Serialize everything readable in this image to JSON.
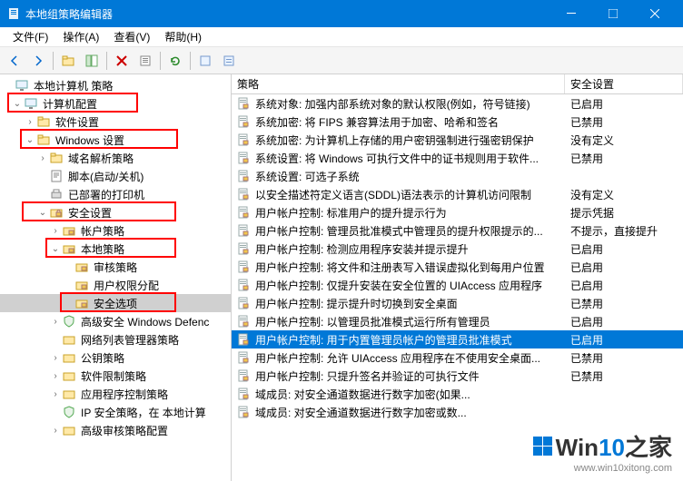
{
  "window": {
    "title": "本地组策略编辑器"
  },
  "menus": {
    "file": "文件(F)",
    "action": "操作(A)",
    "view": "查看(V)",
    "help": "帮助(H)"
  },
  "tree": {
    "root": "本地计算机 策略",
    "computerConfig": "计算机配置",
    "softwareSettings": "软件设置",
    "windowsSettings": "Windows 设置",
    "nameResPolicy": "域名解析策略",
    "scripts": "脚本(启动/关机)",
    "deployedPrinters": "已部署的打印机",
    "securitySettings": "安全设置",
    "accountPolicies": "帐户策略",
    "localPolicies": "本地策略",
    "auditPolicy": "审核策略",
    "userRights": "用户权限分配",
    "securityOptions": "安全选项",
    "windowsDefend": "高级安全 Windows Defenc",
    "netListMgr": "网络列表管理器策略",
    "publicKey": "公钥策略",
    "softwareRestrict": "软件限制策略",
    "appControl": "应用程序控制策略",
    "ipSec": "IP 安全策略，在 本地计算",
    "advAudit": "高级审核策略配置"
  },
  "columns": {
    "policy": "策略",
    "securitySetting": "安全设置"
  },
  "rows": [
    {
      "text": "系统对象: 加强内部系统对象的默认权限(例如，符号链接)",
      "val": "已启用"
    },
    {
      "text": "系统加密: 将 FIPS 兼容算法用于加密、哈希和签名",
      "val": "已禁用"
    },
    {
      "text": "系统加密: 为计算机上存储的用户密钥强制进行强密钥保护",
      "val": "没有定义"
    },
    {
      "text": "系统设置: 将 Windows 可执行文件中的证书规则用于软件...",
      "val": "已禁用"
    },
    {
      "text": "系统设置: 可选子系统",
      "val": ""
    },
    {
      "text": "以安全描述符定义语言(SDDL)语法表示的计算机访问限制",
      "val": "没有定义"
    },
    {
      "text": "用户帐户控制: 标准用户的提升提示行为",
      "val": "提示凭据"
    },
    {
      "text": "用户帐户控制: 管理员批准模式中管理员的提升权限提示的...",
      "val": "不提示，直接提升"
    },
    {
      "text": "用户帐户控制: 检测应用程序安装并提示提升",
      "val": "已启用"
    },
    {
      "text": "用户帐户控制: 将文件和注册表写入错误虚拟化到每用户位置",
      "val": "已启用"
    },
    {
      "text": "用户帐户控制: 仅提升安装在安全位置的 UIAccess 应用程序",
      "val": "已启用"
    },
    {
      "text": "用户帐户控制: 提示提升时切换到安全桌面",
      "val": "已禁用"
    },
    {
      "text": "用户帐户控制: 以管理员批准模式运行所有管理员",
      "val": "已启用"
    },
    {
      "text": "用户帐户控制: 用于内置管理员帐户的管理员批准模式",
      "val": "已启用",
      "selected": true
    },
    {
      "text": "用户帐户控制: 允许 UIAccess 应用程序在不使用安全桌面...",
      "val": "已禁用"
    },
    {
      "text": "用户帐户控制: 只提升签名并验证的可执行文件",
      "val": "已禁用"
    },
    {
      "text": "域成员: 对安全通道数据进行数字加密(如果...",
      "val": ""
    },
    {
      "text": "域成员: 对安全通道数据进行数字加密或数...",
      "val": ""
    }
  ],
  "watermark": {
    "win": "Win",
    "ten": "10",
    "suffix": "之家",
    "url": "www.win10xitong.com"
  }
}
